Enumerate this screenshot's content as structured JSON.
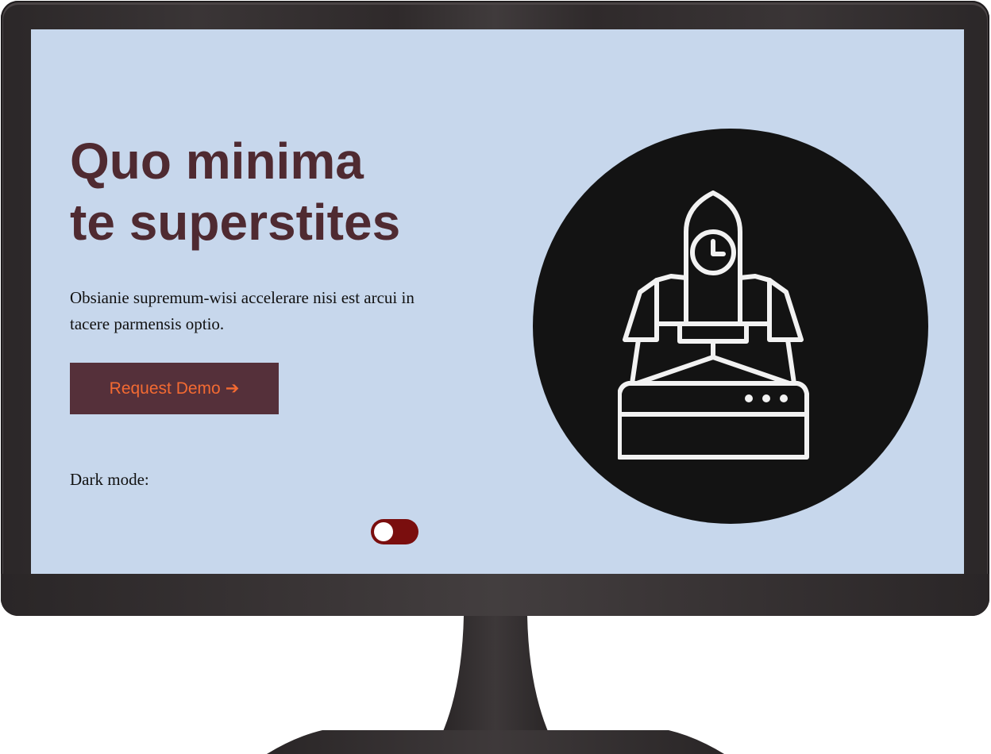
{
  "hero": {
    "headline_line1": "Quo minima",
    "headline_line2": "te superstites",
    "lead": "Obsianie supremum-wisi accelerare nisi est arcui in tacere parmensis optio.",
    "cta_label": "Request Demo",
    "cta_arrow": "➔",
    "illustration_icon": "rocket-launch-icon"
  },
  "settings": {
    "dark_mode_label": "Dark mode:",
    "dark_mode_enabled": false
  },
  "colors": {
    "screen_background": "#c7d7ec",
    "headline": "#4f2a31",
    "button_background": "#55303a",
    "button_text": "#f36a32",
    "toggle_track": "#7a0e0e",
    "illustration_circle": "#131313",
    "illustration_stroke": "#f2f2f2",
    "monitor_frame": "#2f2a2b"
  }
}
